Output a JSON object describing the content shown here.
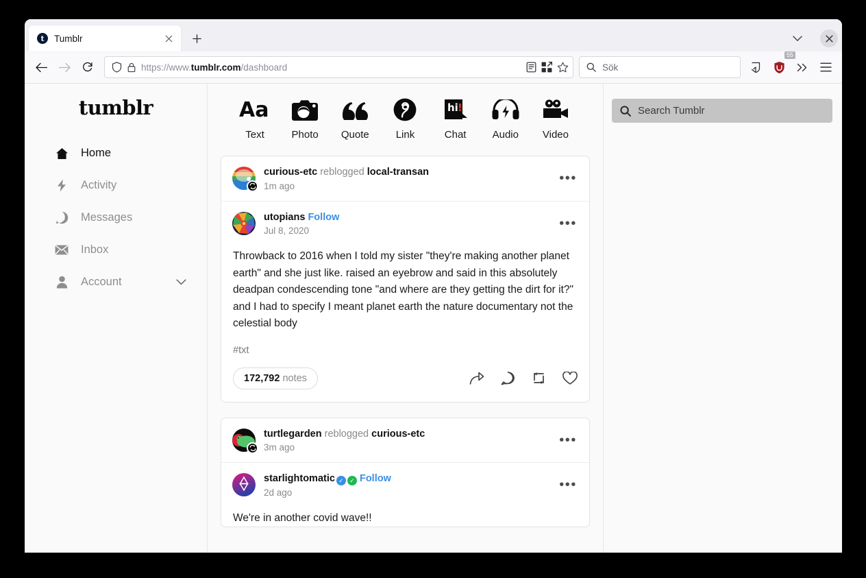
{
  "browser": {
    "tab": {
      "title": "Tumblr",
      "favicon_glyph": "t",
      "close_label": "×"
    },
    "newtab_label": "+",
    "window_controls": {
      "chevron_label": "list-all-tabs",
      "close_label": "×"
    },
    "nav": {
      "back_label": "Back",
      "forward_label": "Forward",
      "reload_label": "Reload"
    },
    "url": {
      "scheme": "https://www.",
      "host": "tumblr.com",
      "path": "/dashboard"
    },
    "search": {
      "placeholder": "Sök"
    },
    "extension_badge_count": "55"
  },
  "sidebar": {
    "logo": "tumblr",
    "items": [
      {
        "label": "Home",
        "icon": "home-icon",
        "active": true
      },
      {
        "label": "Activity",
        "icon": "bolt-icon",
        "active": false
      },
      {
        "label": "Messages",
        "icon": "smiley-chat-icon",
        "active": false
      },
      {
        "label": "Inbox",
        "icon": "envelope-icon",
        "active": false
      },
      {
        "label": "Account",
        "icon": "person-icon",
        "active": false,
        "chevron": "⌄"
      }
    ]
  },
  "composer": {
    "items": [
      {
        "label": "Text",
        "icon": "text-aa-icon"
      },
      {
        "label": "Photo",
        "icon": "camera-icon"
      },
      {
        "label": "Quote",
        "icon": "quote-marks-icon"
      },
      {
        "label": "Link",
        "icon": "link-chain-icon"
      },
      {
        "label": "Chat",
        "icon": "chat-bubble-hi-icon"
      },
      {
        "label": "Audio",
        "icon": "headphones-icon"
      },
      {
        "label": "Video",
        "icon": "video-camera-icon"
      }
    ]
  },
  "right_sidebar": {
    "search": {
      "placeholder": "Search Tumblr",
      "icon": "search-icon"
    }
  },
  "posts": [
    {
      "reblog_header": {
        "actor": "curious-etc",
        "verb": "reblogged",
        "source": "local-transan",
        "time": "1m ago",
        "avatar_colors": [
          "#e23b2e",
          "#f2a83b",
          "#3fa34d",
          "#2b7fd4",
          "#ffffff"
        ]
      },
      "author_header": {
        "name": "utopians",
        "follow_label": "Follow",
        "date": "Jul 8, 2020",
        "avatar_colors": [
          "#e8432f",
          "#f0a92c",
          "#2f73c2",
          "#3ea752"
        ]
      },
      "body": "Throwback to 2016 when I told my sister \"they're making another planet earth\" and she just like. raised an eyebrow and said in this absolutely deadpan condescending tone \"and where are they getting the dirt for it?\" and I had to specify I meant planet earth the nature documentary not the celestial body",
      "tags": "#txt",
      "notes_count": "172,792",
      "notes_label": "notes",
      "actions": [
        "share-icon",
        "comment-icon",
        "reblog-icon",
        "like-heart-icon"
      ],
      "menu_label": "•••"
    },
    {
      "reblog_header": {
        "actor": "turtlegarden",
        "verb": "reblogged",
        "source": "curious-etc",
        "time": "3m ago",
        "avatar_colors": [
          "#0d0d0d",
          "#d9263a",
          "#54c46a"
        ]
      },
      "author_header": {
        "name": "starlightomatic",
        "badges": [
          "blue-check-badge",
          "green-check-badge"
        ],
        "follow_label": "Follow",
        "date": "2d ago",
        "avatar_colors": [
          "#e0197f",
          "#2b3fa8"
        ]
      },
      "body": "We're in another covid wave!!",
      "menu_label": "•••"
    }
  ],
  "colors": {
    "accent_blue": "#3b8ee6",
    "page_bg": "#fafafa",
    "card_bg": "#ffffff",
    "text_primary": "#1a1a1a",
    "text_muted": "#8a8a8a",
    "verified_blue": "#3b8ee6",
    "verified_green": "#1db954"
  }
}
